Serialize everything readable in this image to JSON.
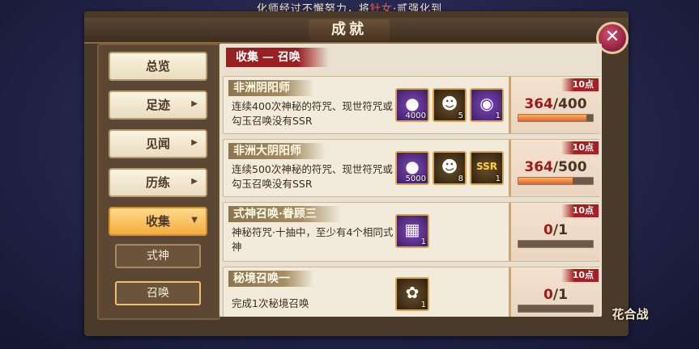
{
  "ticker": {
    "prefix": "化师经过不懈努力，将",
    "highlight": "针女",
    "suffix": "·贰强化到"
  },
  "window": {
    "title": "成就",
    "close_symbol": "✕"
  },
  "sidebar": {
    "items": [
      {
        "label": "总览",
        "arrow": ""
      },
      {
        "label": "足迹",
        "arrow": "▶"
      },
      {
        "label": "见闻",
        "arrow": "▶"
      },
      {
        "label": "历练",
        "arrow": "▶"
      },
      {
        "label": "收集",
        "arrow": "▼"
      }
    ],
    "subitems": [
      {
        "label": "式神"
      },
      {
        "label": "召唤"
      }
    ],
    "selected_sub": "召唤"
  },
  "section_title": "收集 — 召唤",
  "achievements": [
    {
      "name": "非洲阴阳师",
      "desc": "连续400次神秘的符咒、现世符咒或勾玉召唤没有SSR",
      "rewards": [
        {
          "icon": "amulet-icon",
          "count": "4000"
        },
        {
          "icon": "daruma-icon",
          "count": "5"
        },
        {
          "icon": "bell-icon",
          "count": "1"
        }
      ],
      "points": "10点",
      "current": "364",
      "total": "/400",
      "progress": 0.91
    },
    {
      "name": "非洲大阴阳师",
      "desc": "连续500次神秘的符咒、现世符咒或勾玉召唤没有SSR",
      "rewards": [
        {
          "icon": "amulet-icon",
          "count": "5000"
        },
        {
          "icon": "daruma-icon",
          "count": "8"
        },
        {
          "icon": "ssr-icon",
          "count": "1"
        }
      ],
      "points": "10点",
      "current": "364",
      "total": "/500",
      "progress": 0.728
    },
    {
      "name": "式神召唤·眷顾三",
      "desc": "神秘符咒·十抽中，至少有4个相同式神",
      "rewards": [
        {
          "icon": "talisman-book-icon",
          "count": "1"
        }
      ],
      "points": "10点",
      "current": "0",
      "total": "/1",
      "progress": 0
    },
    {
      "name": "秘境召唤一",
      "desc": "完成1次秘境召唤",
      "rewards": [
        {
          "icon": "character-card-icon",
          "count": "1"
        }
      ],
      "points": "10点",
      "current": "0",
      "total": "/1",
      "progress": 0
    }
  ],
  "logo": "花合战"
}
